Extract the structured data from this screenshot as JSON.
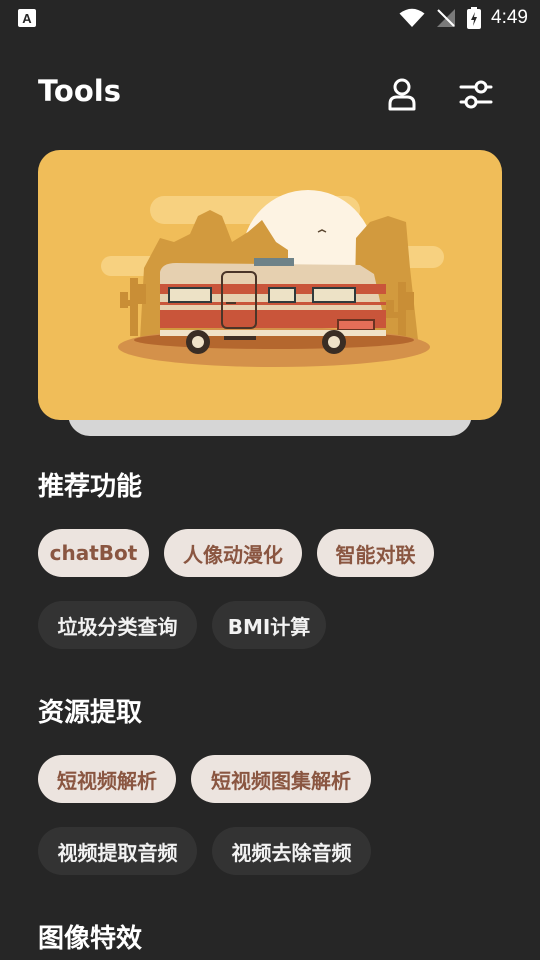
{
  "status_bar": {
    "time": "4:49"
  },
  "header": {
    "title": "Tools"
  },
  "sections": [
    {
      "title": "推荐功能",
      "chips": [
        "chatBot",
        "人像动漫化",
        "智能对联",
        "垃圾分类查询",
        "BMI计算"
      ]
    },
    {
      "title": "资源提取",
      "chips": [
        "短视频解析",
        "短视频图集解析",
        "视频提取音频",
        "视频去除音频"
      ]
    },
    {
      "title": "图像特效",
      "chips": []
    }
  ],
  "colors": {
    "background": "#262626",
    "banner": "#f0bd59",
    "chip_light": "#ece4df",
    "chip_light_text": "#8a5641",
    "chip_dark": "#333333"
  }
}
